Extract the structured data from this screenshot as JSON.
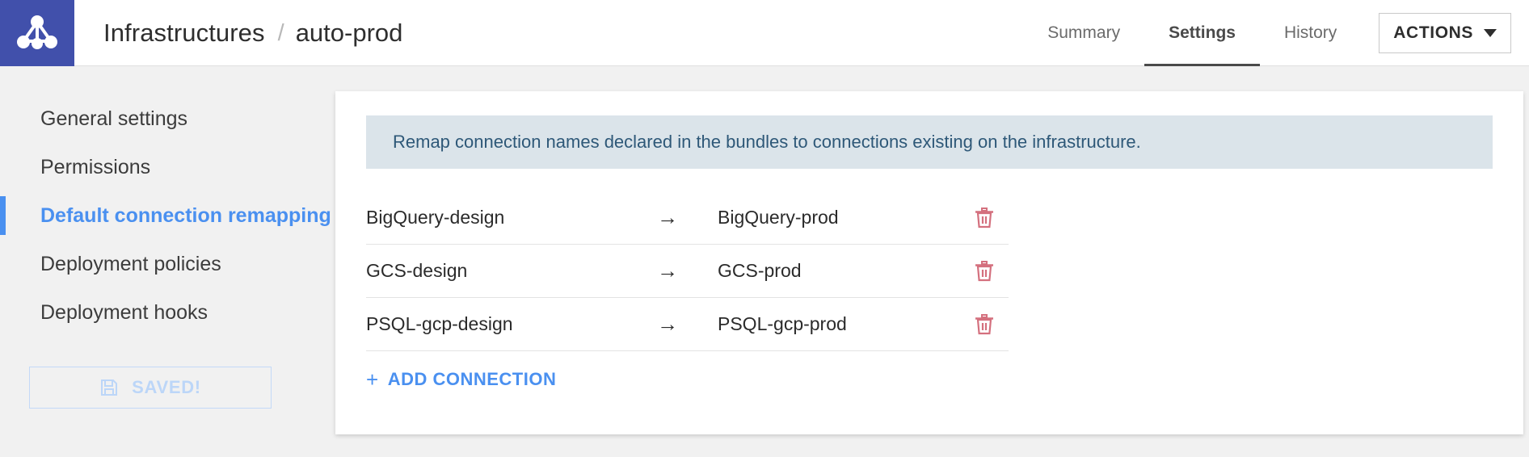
{
  "header": {
    "logo_icon": "network-nodes-logo",
    "logo_color": "#4150ab",
    "breadcrumb": {
      "root": "Infrastructures",
      "separator": "/",
      "current": "auto-prod"
    },
    "tabs": [
      {
        "label": "Summary",
        "active": false
      },
      {
        "label": "Settings",
        "active": true
      },
      {
        "label": "History",
        "active": false
      }
    ],
    "actions_button": {
      "label": "ACTIONS",
      "icon": "chevron-down-icon"
    }
  },
  "sidebar": {
    "items": [
      {
        "label": "General settings",
        "active": false
      },
      {
        "label": "Permissions",
        "active": false
      },
      {
        "label": "Default connection remapping",
        "active": true
      },
      {
        "label": "Deployment policies",
        "active": false
      },
      {
        "label": "Deployment hooks",
        "active": false
      }
    ],
    "active_color": "#4a90f0",
    "save_button": {
      "label": "SAVED!",
      "icon": "floppy-disk-icon",
      "disabled": true,
      "color": "#bcd6f8"
    }
  },
  "main": {
    "banner": {
      "text": "Remap connection names declared in the bundles to connections existing on the infrastructure.",
      "background": "#dbe4ea",
      "text_color": "#2e5878"
    },
    "connections": {
      "arrow": "→",
      "delete_icon": "trash-icon",
      "delete_icon_color": "#d4707e",
      "rows": [
        {
          "source": "BigQuery-design",
          "target": "BigQuery-prod"
        },
        {
          "source": "GCS-design",
          "target": "GCS-prod"
        },
        {
          "source": "PSQL-gcp-design",
          "target": "PSQL-gcp-prod"
        }
      ]
    },
    "add_connection": {
      "label": "ADD CONNECTION",
      "icon": "plus-icon",
      "color": "#4a90f0"
    }
  }
}
